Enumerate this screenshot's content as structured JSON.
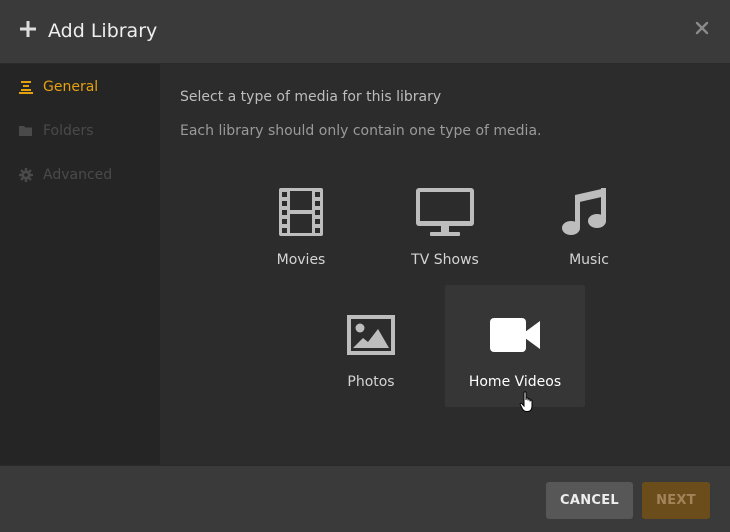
{
  "header": {
    "title": "Add Library",
    "plus_icon": "plus-icon",
    "close_icon": "close-icon"
  },
  "sidebar": {
    "items": [
      {
        "label": "General",
        "icon": "general-icon",
        "state": "active"
      },
      {
        "label": "Folders",
        "icon": "folder-icon",
        "state": "disabled"
      },
      {
        "label": "Advanced",
        "icon": "gear-icon",
        "state": "disabled"
      }
    ]
  },
  "content": {
    "instruction": "Select a type of media for this library",
    "note": "Each library should only contain one type of media.",
    "media_types": [
      {
        "label": "Movies",
        "icon": "film-icon"
      },
      {
        "label": "TV Shows",
        "icon": "tv-icon"
      },
      {
        "label": "Music",
        "icon": "music-note-icon"
      },
      {
        "label": "Photos",
        "icon": "photo-icon"
      },
      {
        "label": "Home Videos",
        "icon": "video-camera-icon",
        "hovered": true
      }
    ]
  },
  "footer": {
    "cancel_label": "CANCEL",
    "next_label": "NEXT"
  },
  "colors": {
    "accent": "#e5a00d",
    "next_disabled_bg": "#6b4d1c"
  }
}
